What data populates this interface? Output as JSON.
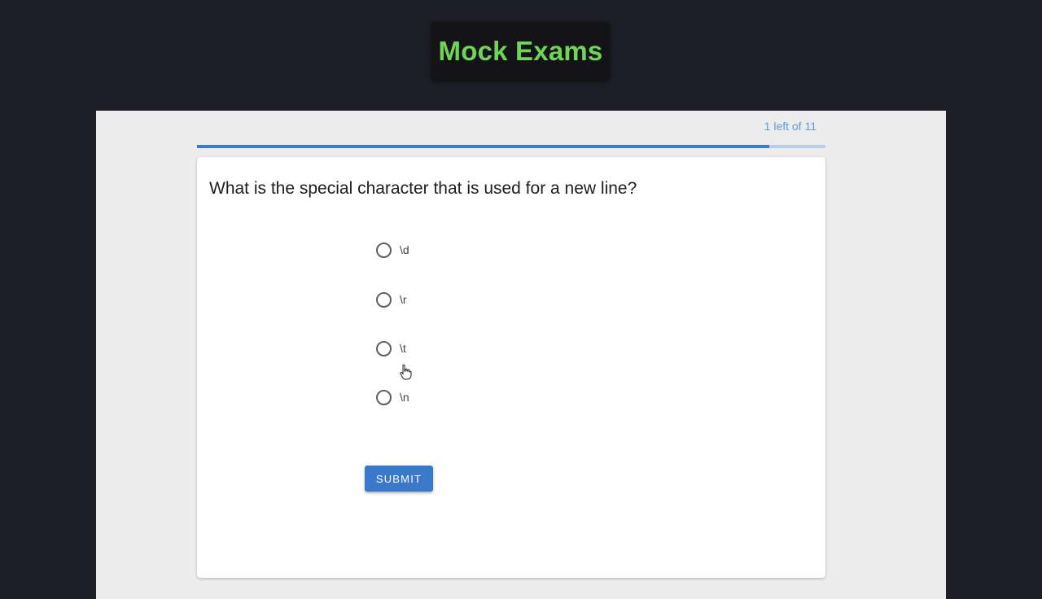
{
  "header": {
    "title": "Mock Exams"
  },
  "progress": {
    "label": "1 left of 11",
    "fraction": 0.91
  },
  "question": {
    "text": "What is the special character that is used for a new line?",
    "options": [
      {
        "label": "\\d"
      },
      {
        "label": "\\r"
      },
      {
        "label": "\\t"
      },
      {
        "label": "\\n"
      }
    ]
  },
  "actions": {
    "submit_label": "SUBMIT"
  },
  "colors": {
    "title": "#6fd655",
    "accent": "#3a78c9",
    "progress_label": "#5b9bd5"
  },
  "icons": {
    "cursor": "pointer-hand-cursor-icon"
  }
}
